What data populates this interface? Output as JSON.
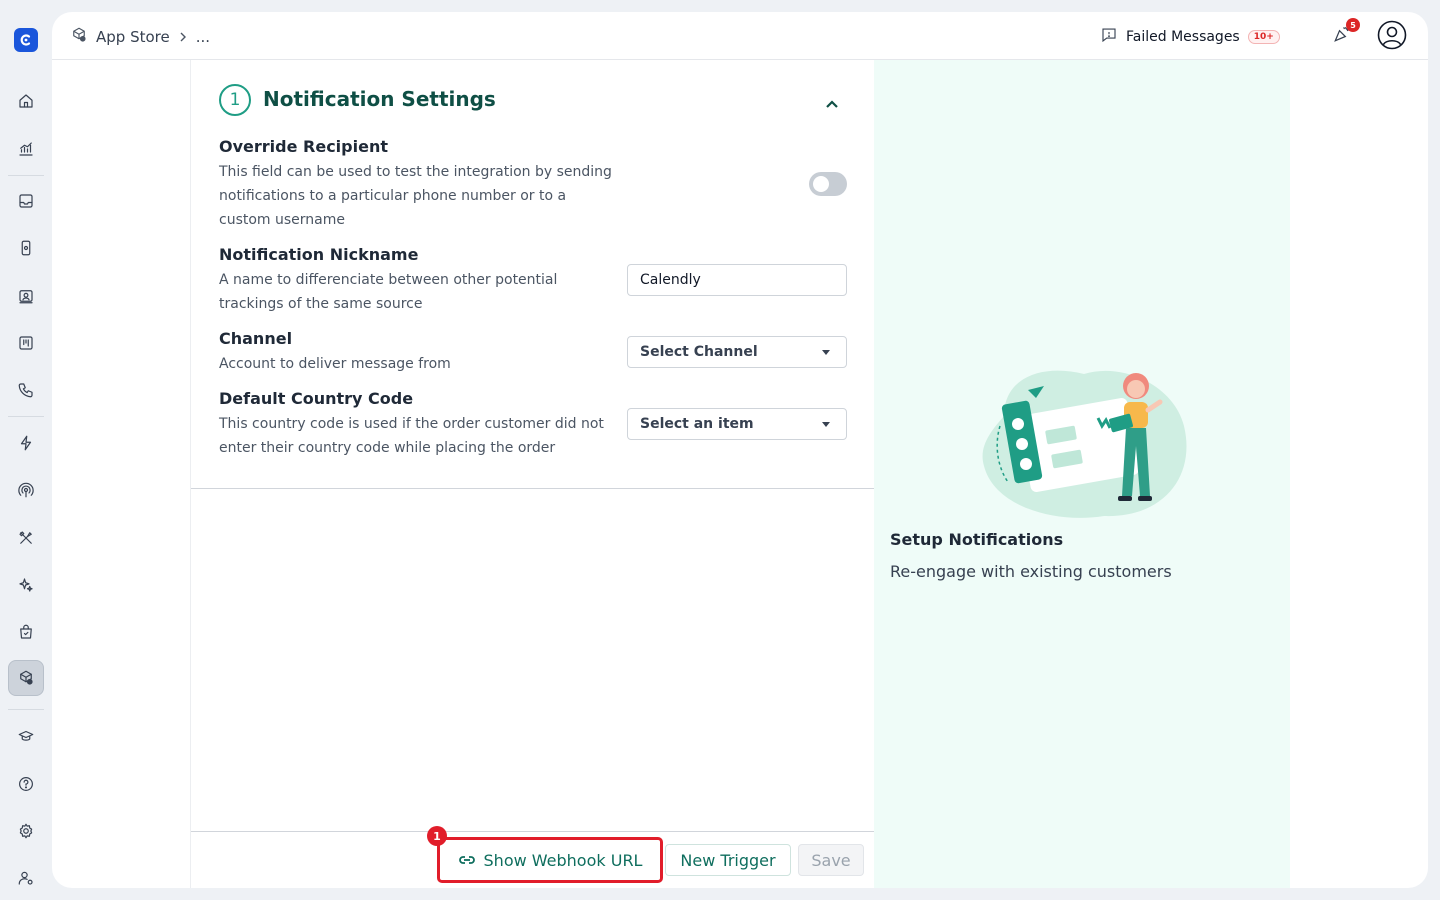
{
  "colors": {
    "accent": "#0f6e5e",
    "step": "#1f9d85",
    "highlight": "#e11d2a",
    "info_panel_bg": "#effcf8"
  },
  "sidebar": {
    "logo_icon": "brand-logo-icon",
    "items": [
      {
        "icon": "home-icon"
      },
      {
        "icon": "analytics-icon"
      },
      {
        "icon": "inbox-icon"
      },
      {
        "icon": "device-icon"
      },
      {
        "icon": "contacts-icon"
      },
      {
        "icon": "board-icon"
      },
      {
        "icon": "phone-icon"
      },
      {
        "icon": "lightning-icon"
      },
      {
        "icon": "broadcast-icon"
      },
      {
        "icon": "tools-icon"
      },
      {
        "icon": "sparkles-icon"
      },
      {
        "icon": "shopping-bag-icon"
      },
      {
        "icon": "app-store-icon",
        "active": true
      },
      {
        "icon": "graduation-cap-icon"
      },
      {
        "icon": "help-icon"
      },
      {
        "icon": "settings-icon"
      },
      {
        "icon": "user-settings-icon"
      }
    ]
  },
  "header": {
    "breadcrumb": {
      "root": "App Store",
      "current": "..."
    },
    "failed_messages_label": "Failed Messages",
    "failed_messages_count": "10+",
    "notification_count": "5"
  },
  "section": {
    "step_number": "1",
    "title": "Notification Settings"
  },
  "fields": {
    "override": {
      "title": "Override Recipient",
      "desc": "This field can be used to test the integration by sending notifications to a particular phone number or to a custom username",
      "enabled": false
    },
    "nickname": {
      "title": "Notification Nickname",
      "desc": "A name to differenciate between other potential trackings of the same source",
      "value": "Calendly"
    },
    "channel": {
      "title": "Channel",
      "desc": "Account to deliver message from",
      "selected": "Select Channel"
    },
    "country": {
      "title": "Default Country Code",
      "desc": "This country code is used if the order customer did not enter their country code while placing the order",
      "selected": "Select an item"
    }
  },
  "footer": {
    "step_badge": "1",
    "webhook_label": "Show Webhook URL",
    "trigger_label": "New Trigger",
    "save_label": "Save"
  },
  "info": {
    "title": "Setup Notifications",
    "subtitle": "Re-engage with existing customers"
  }
}
